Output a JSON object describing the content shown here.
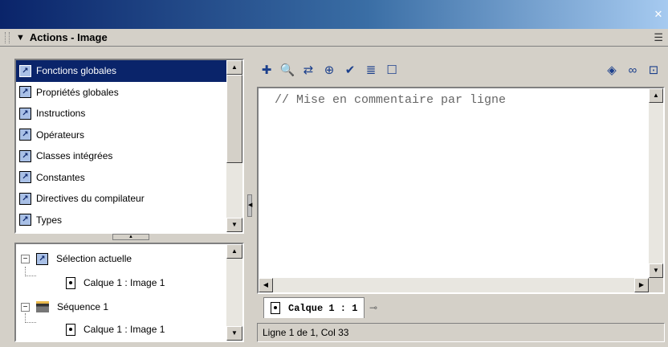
{
  "panel": {
    "title": "Actions - Image"
  },
  "categories": [
    "Fonctions globales",
    "Propriétés globales",
    "Instructions",
    "Opérateurs",
    "Classes intégrées",
    "Constantes",
    "Directives du compilateur",
    "Types"
  ],
  "tree": {
    "selection": "Sélection actuelle",
    "selection_child": "Calque 1 : Image 1",
    "sequence": "Séquence 1",
    "sequence_child": "Calque 1 : Image 1"
  },
  "editor": {
    "code": "// Mise en commentaire par ligne"
  },
  "tab": {
    "label": "Calque 1 : 1"
  },
  "status": {
    "text": "Ligne 1 de 1, Col 33"
  },
  "colors": {
    "selection": "#0a246a",
    "title_bar": "#0a246a",
    "chrome": "#d4d0c8"
  }
}
